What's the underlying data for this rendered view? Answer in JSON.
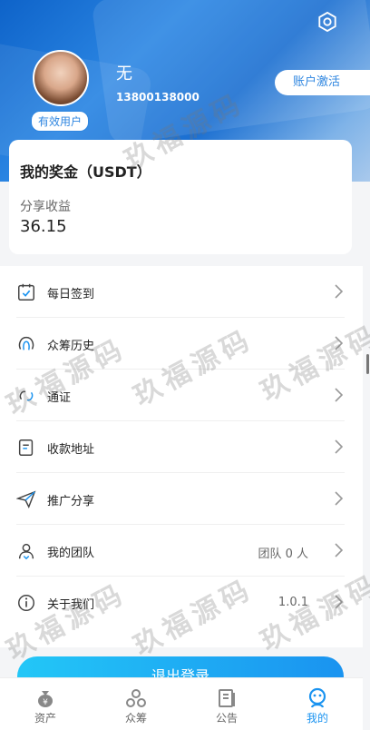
{
  "header": {
    "username": "无",
    "phone": "13800138000",
    "badge": "有效用户",
    "activate_label": "账户激活"
  },
  "bonus": {
    "title": "我的奖金（USDT）",
    "share_label": "分享收益",
    "share_value": "36.15"
  },
  "menu": {
    "items": [
      {
        "label": "每日签到",
        "icon": "calendar-check-icon"
      },
      {
        "label": "众筹历史",
        "icon": "history-icon"
      },
      {
        "label": "通证",
        "icon": "token-icon"
      },
      {
        "label": "收款地址",
        "icon": "document-icon"
      },
      {
        "label": "推广分享",
        "icon": "paper-plane-icon"
      },
      {
        "label": "我的团队",
        "icon": "team-icon",
        "value": "团队 0 人"
      },
      {
        "label": "关于我们",
        "icon": "info-icon",
        "value": "1.0.1"
      }
    ]
  },
  "logout_label": "退出登录",
  "tabs": [
    {
      "label": "资产",
      "icon": "money-bag-icon",
      "active": false
    },
    {
      "label": "众筹",
      "icon": "crowdfund-icon",
      "active": false
    },
    {
      "label": "公告",
      "icon": "notice-icon",
      "active": false
    },
    {
      "label": "我的",
      "icon": "profile-icon",
      "active": true
    }
  ],
  "watermark": "玖福源码",
  "colors": {
    "accent": "#1a93f0",
    "header_blue": "#1b6fd1",
    "logout_start": "#23c7f7"
  }
}
